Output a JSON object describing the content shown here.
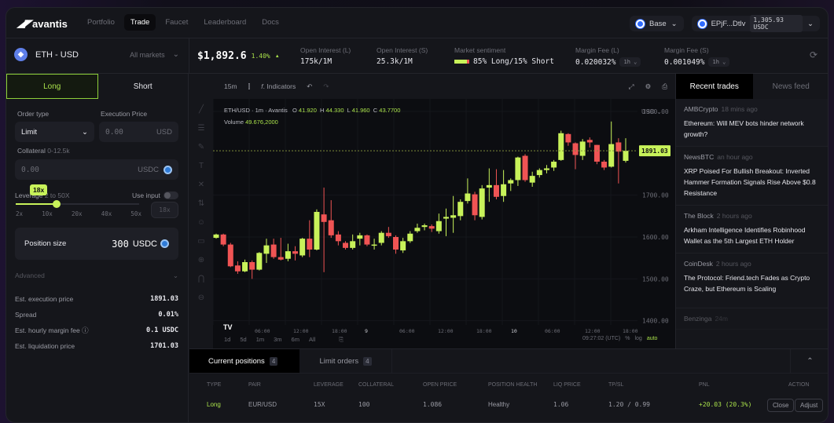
{
  "header": {
    "logo": "avantis",
    "nav": [
      {
        "label": "Portfolio"
      },
      {
        "label": "Trade",
        "active": true
      },
      {
        "label": "Faucet"
      },
      {
        "label": "Leaderboard"
      },
      {
        "label": "Docs"
      }
    ],
    "network": "Base",
    "wallet": "EPjF...Dtlv",
    "balance": "1,305.93 USDC"
  },
  "market": {
    "pair": "ETH - USD",
    "all_markets": "All markets",
    "price": "$1,892.6",
    "change": "1.40%",
    "stats": [
      {
        "label": "Open Interest (L)",
        "value": "175k/1M"
      },
      {
        "label": "Open Interest (S)",
        "value": "25.3k/1M"
      }
    ],
    "sentiment_label": "Market sentiment",
    "sentiment": "85% Long/15% Short",
    "long_pct": 85,
    "fees": [
      {
        "label": "Margin Fee (L)",
        "value": "0.020032%",
        "period": "1h"
      },
      {
        "label": "Margin Fee (S)",
        "value": "0.001049%",
        "period": "1h"
      }
    ]
  },
  "order": {
    "tab_long": "Long",
    "tab_short": "Short",
    "order_type_label": "Order type",
    "order_type": "Limit",
    "exec_price_label": "Execution Price",
    "exec_price_placeholder": "0.00",
    "exec_unit": "USD",
    "collateral_label": "Collateral",
    "collateral_range": "0-12.5k",
    "collateral_placeholder": "0.00",
    "collateral_unit": "USDC",
    "leverage_label": "Leverage",
    "leverage_range": "2 to 50X",
    "leverage_value": "18x",
    "leverage_fraction": 0.33,
    "use_input": "Use input",
    "leverage_ticks": [
      "2x",
      "10x",
      "20x",
      "40x",
      "50x"
    ],
    "leverage_input": "18x",
    "position_size_label": "Position size",
    "position_size": "300",
    "position_unit": "USDC",
    "advanced": "Advanced",
    "details": [
      {
        "label": "Est. execution price",
        "value": "1891.03"
      },
      {
        "label": "Spread",
        "value": "0.01%"
      },
      {
        "label": "Est. hourly margin fee",
        "value": "0.1 USDC"
      },
      {
        "label": "Est. liquidation price",
        "value": "1701.03"
      }
    ]
  },
  "chart_toolbar": {
    "interval": "15m",
    "indicators": "Indicators"
  },
  "chart_legend": {
    "symbol": "ETH/USD",
    "interval": "1m",
    "source": "Avantis",
    "o": "41.920",
    "h": "44.330",
    "l": "41.960",
    "c": "43.7700",
    "volume_label": "Volume",
    "volume": "49.676,2000"
  },
  "chart_footer": {
    "ranges": [
      "1d",
      "5d",
      "1m",
      "3m",
      "6m",
      "All"
    ],
    "time": "09:27:02 (UTC)",
    "pct": "%",
    "log": "log",
    "auto": "auto"
  },
  "chart_data": {
    "type": "candlestick",
    "currency": "USD",
    "current_price_label": "1891.03",
    "y_ticks": [
      "1900.00",
      "1700.00",
      "1600.00",
      "1500.00",
      "1400.00"
    ],
    "y_tick_values": [
      1900,
      1700,
      1600,
      1500,
      1400
    ],
    "ylim": [
      1390,
      1930
    ],
    "x_ticks": [
      "06:00",
      "12:00",
      "18:00",
      "9",
      "06:00",
      "12:00",
      "18:00",
      "10",
      "06:00",
      "12:00",
      "18:00"
    ],
    "ohlc": [
      [
        1598,
        1608,
        1596,
        1606
      ],
      [
        1606,
        1608,
        1578,
        1582
      ],
      [
        1582,
        1586,
        1528,
        1530
      ],
      [
        1532,
        1542,
        1512,
        1518
      ],
      [
        1518,
        1546,
        1516,
        1540
      ],
      [
        1540,
        1544,
        1500,
        1522
      ],
      [
        1522,
        1564,
        1520,
        1562
      ],
      [
        1560,
        1596,
        1538,
        1580
      ],
      [
        1582,
        1596,
        1548,
        1552
      ],
      [
        1552,
        1598,
        1544,
        1546
      ],
      [
        1548,
        1584,
        1542,
        1566
      ],
      [
        1566,
        1578,
        1544,
        1560
      ],
      [
        1556,
        1598,
        1552,
        1596
      ],
      [
        1596,
        1640,
        1552,
        1570
      ],
      [
        1570,
        1666,
        1568,
        1660
      ],
      [
        1654,
        1718,
        1516,
        1636
      ],
      [
        1640,
        1688,
        1598,
        1604
      ],
      [
        1606,
        1614,
        1580,
        1590
      ],
      [
        1586,
        1590,
        1570,
        1574
      ],
      [
        1574,
        1606,
        1570,
        1590
      ],
      [
        1596,
        1610,
        1580,
        1604
      ],
      [
        1604,
        1606,
        1578,
        1582
      ],
      [
        1580,
        1596,
        1570,
        1582
      ],
      [
        1586,
        1614,
        1580,
        1610
      ],
      [
        1610,
        1624,
        1598,
        1602
      ],
      [
        1600,
        1604,
        1560,
        1570
      ],
      [
        1568,
        1598,
        1562,
        1590
      ],
      [
        1590,
        1614,
        1586,
        1608
      ],
      [
        1614,
        1632,
        1610,
        1622
      ],
      [
        1624,
        1632,
        1616,
        1628
      ],
      [
        1626,
        1630,
        1612,
        1620
      ],
      [
        1614,
        1656,
        1608,
        1638
      ],
      [
        1644,
        1668,
        1602,
        1648
      ],
      [
        1646,
        1698,
        1610,
        1652
      ],
      [
        1650,
        1690,
        1640,
        1684
      ],
      [
        1686,
        1740,
        1680,
        1704
      ],
      [
        1702,
        1708,
        1640,
        1652
      ],
      [
        1648,
        1724,
        1642,
        1716
      ],
      [
        1718,
        1764,
        1684,
        1724
      ],
      [
        1724,
        1762,
        1690,
        1696
      ],
      [
        1698,
        1760,
        1684,
        1726
      ],
      [
        1728,
        1740,
        1710,
        1736
      ],
      [
        1736,
        1792,
        1722,
        1790
      ],
      [
        1794,
        1798,
        1732,
        1736
      ],
      [
        1730,
        1756,
        1720,
        1746
      ],
      [
        1748,
        1764,
        1742,
        1760
      ],
      [
        1760,
        1772,
        1752,
        1764
      ],
      [
        1766,
        1784,
        1758,
        1780
      ],
      [
        1784,
        1854,
        1782,
        1848
      ],
      [
        1846,
        1848,
        1818,
        1826
      ],
      [
        1824,
        1826,
        1762,
        1796
      ],
      [
        1794,
        1834,
        1784,
        1828
      ],
      [
        1832,
        1838,
        1814,
        1826
      ],
      [
        1820,
        1820,
        1774,
        1780
      ],
      [
        1780,
        1784,
        1760,
        1766
      ],
      [
        1768,
        1876,
        1766,
        1822
      ],
      [
        1826,
        1836,
        1728,
        1804
      ],
      [
        1782,
        1836,
        1778,
        1806
      ]
    ],
    "up_color": "#c8f25a",
    "down_color": "#f05454"
  },
  "feed": {
    "tabs": [
      "Recent trades",
      "News feed"
    ],
    "items": [
      {
        "source": "AMBCrypto",
        "time": "18 mins ago",
        "title": "Ethereum: Will MEV bots hinder network growth?"
      },
      {
        "source": "NewsBTC",
        "time": "an hour ago",
        "title": "XRP Poised For Bullish Breakout: Inverted Hammer Formation Signals Rise Above $0.8 Resistance"
      },
      {
        "source": "The Block",
        "time": "2 hours ago",
        "title": "Arkham Intelligence Identifies Robinhood Wallet as the 5th Largest ETH Holder"
      },
      {
        "source": "CoinDesk",
        "time": "2 hours ago",
        "title": "The Protocol: Friend.tech Fades as Crypto Craze, but Ethereum is Scaling"
      },
      {
        "source": "Benzinga",
        "time": "24m",
        "title": ""
      }
    ]
  },
  "positions": {
    "tabs": [
      {
        "label": "Current positions",
        "count": "4"
      },
      {
        "label": "Limit orders",
        "count": "4"
      }
    ],
    "columns": [
      "TYPE",
      "PAIR",
      "LEVERAGE",
      "COLLATERAL",
      "OPEN PRICE",
      "POSITION HEALTH",
      "LIQ PRICE",
      "TP/SL",
      "PNL",
      "ACTION"
    ],
    "rows": [
      {
        "type": "Long",
        "pair": "EUR/USD",
        "leverage": "15X",
        "collateral": "100",
        "open_price": "1.086",
        "health": "Healthy",
        "liq_price": "1.06",
        "tpsl": "1.20 / 0.99",
        "pnl": "+20.03 (20.3%)",
        "close": "Close",
        "adjust": "Adjust"
      }
    ]
  },
  "colors": {
    "accent": "#b4ea3c",
    "down": "#f05454",
    "bg": "#15161b"
  }
}
